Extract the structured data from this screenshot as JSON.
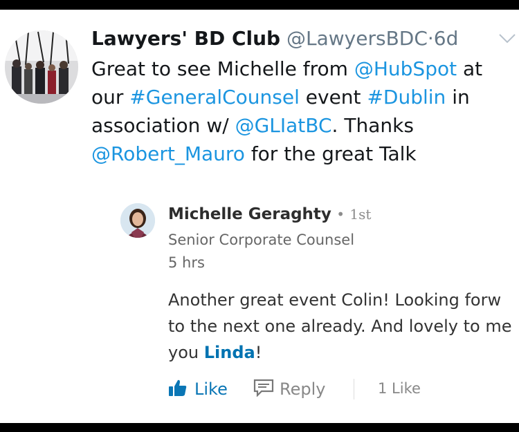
{
  "tweet": {
    "author_name": "Lawyers' BD Club",
    "handle": "@LawyersBDC",
    "separator": "·",
    "age": "6d",
    "text": {
      "p1": "Great to see Michelle from ",
      "mention_hubspot": "@HubSpot",
      "p2": " at our ",
      "hashtag_gc": "#GeneralCounsel",
      "p3": " event ",
      "hashtag_dublin": "#Dublin",
      "p4": " in association w/ ",
      "mention_glat": "@GLIatBC",
      "p5": ". Thanks ",
      "mention_robert": "@Robert_Mauro",
      "p6": " for the great Talk"
    }
  },
  "comment": {
    "author_name": "Michelle Geraghty",
    "separator": "•",
    "degree": "1st",
    "headline": "Senior Corporate Counsel",
    "time": "5 hrs",
    "line1": "Another great event Colin! Looking forw",
    "line2": "to the next one already. And lovely to me",
    "line3_pre": "you ",
    "mention": "Linda",
    "line3_post": "!"
  },
  "actions": {
    "like_label": "Like",
    "reply_label": "Reply",
    "likes_count": "1 Like"
  },
  "colors": {
    "link": "#1b95e0",
    "linkedin_blue": "#0a76b5",
    "muted": "#657786"
  }
}
